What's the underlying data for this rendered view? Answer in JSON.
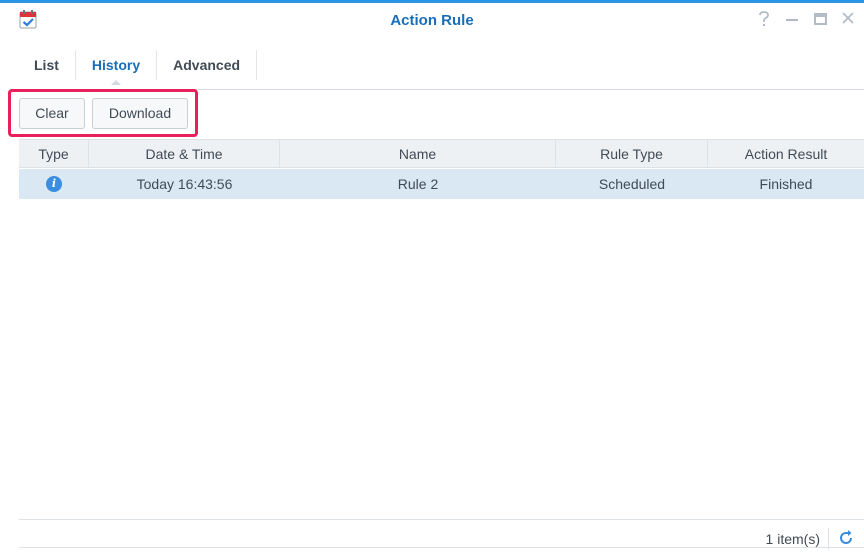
{
  "window": {
    "title": "Action Rule",
    "controls": [
      "help-icon",
      "minimize-icon",
      "maximize-icon",
      "close-icon"
    ],
    "accent": "#2b95e6"
  },
  "tabs": [
    {
      "label": "List",
      "active": false
    },
    {
      "label": "History",
      "active": true
    },
    {
      "label": "Advanced",
      "active": false
    }
  ],
  "toolbar": {
    "clear_label": "Clear",
    "download_label": "Download",
    "highlight_color": "#e8205c"
  },
  "grid": {
    "columns": [
      "Type",
      "Date & Time",
      "Name",
      "Rule Type",
      "Action Result"
    ],
    "rows": [
      {
        "type_icon": "info-icon",
        "datetime": "Today 16:43:56",
        "name": "Rule 2",
        "rule_type": "Scheduled",
        "result": "Finished"
      }
    ]
  },
  "footer": {
    "count": "1 item(s)"
  }
}
